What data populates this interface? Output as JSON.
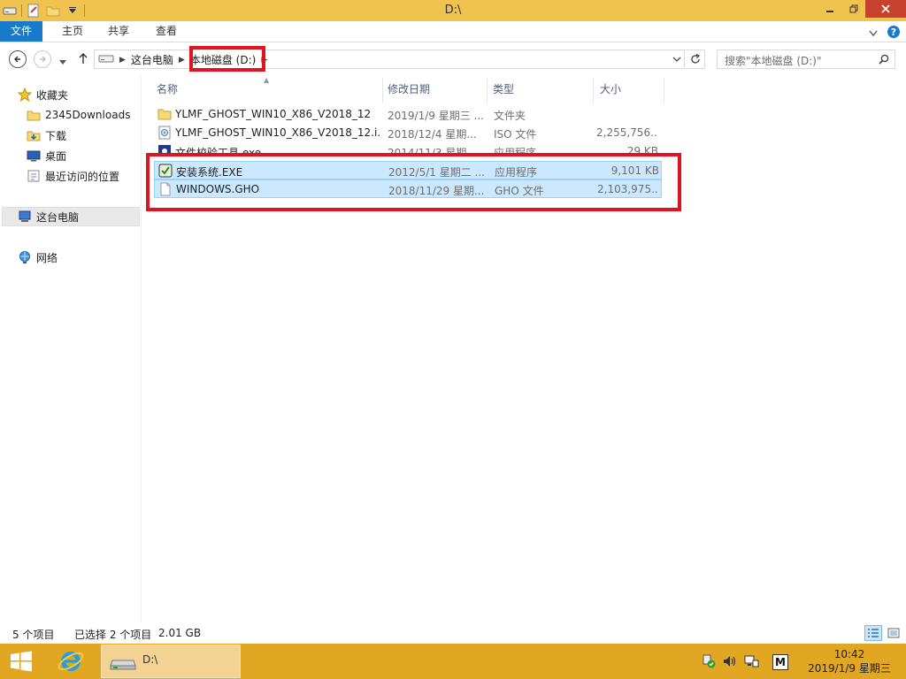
{
  "window": {
    "title": "D:\\"
  },
  "ribbon": {
    "tabs": [
      "文件",
      "主页",
      "共享",
      "查看"
    ]
  },
  "address": {
    "crumbs": [
      "这台电脑",
      "本地磁盘 (D:)"
    ],
    "search_placeholder": "搜索\"本地磁盘 (D:)\""
  },
  "navpane": {
    "favorites": "收藏夹",
    "favorites_items": [
      "2345Downloads",
      "下载",
      "桌面",
      "最近访问的位置"
    ],
    "this_pc": "这台电脑",
    "network": "网络"
  },
  "columns": {
    "name": "名称",
    "date": "修改日期",
    "type": "类型",
    "size": "大小"
  },
  "files": [
    {
      "name": "YLMF_GHOST_WIN10_X86_V2018_12",
      "date": "2019/1/9 星期三 ...",
      "type": "文件夹",
      "size": "",
      "icon": "folder-icon",
      "selected": false
    },
    {
      "name": "YLMF_GHOST_WIN10_X86_V2018_12.i...",
      "date": "2018/12/4 星期...",
      "type": "ISO 文件",
      "size": "2,255,756...",
      "icon": "iso-file-icon",
      "selected": false
    },
    {
      "name": "文件校验工具.exe",
      "date": "2014/11/3 星期...",
      "type": "应用程序",
      "size": "29 KB",
      "icon": "checksum-app-icon",
      "selected": false
    },
    {
      "name": "安装系统.EXE",
      "date": "2012/5/1 星期二 ...",
      "type": "应用程序",
      "size": "9,101 KB",
      "icon": "installer-app-icon",
      "selected": true
    },
    {
      "name": "WINDOWS.GHO",
      "date": "2018/11/29 星期...",
      "type": "GHO 文件",
      "size": "2,103,975...",
      "icon": "blank-file-icon",
      "selected": true
    }
  ],
  "status": {
    "count": "5 个项目",
    "selected": "已选择 2 个项目",
    "selected_size": "2.01 GB"
  },
  "taskbar": {
    "explorer_label": "D:\\",
    "ime": "M",
    "time": "10:42",
    "date": "2019/1/9 星期三"
  },
  "colors": {
    "titlebar": "#f0c34f",
    "taskbar": "#e2a722",
    "file_tab": "#1979ca",
    "selection": "#cce8ff",
    "highlight_box": "#e0141e"
  }
}
